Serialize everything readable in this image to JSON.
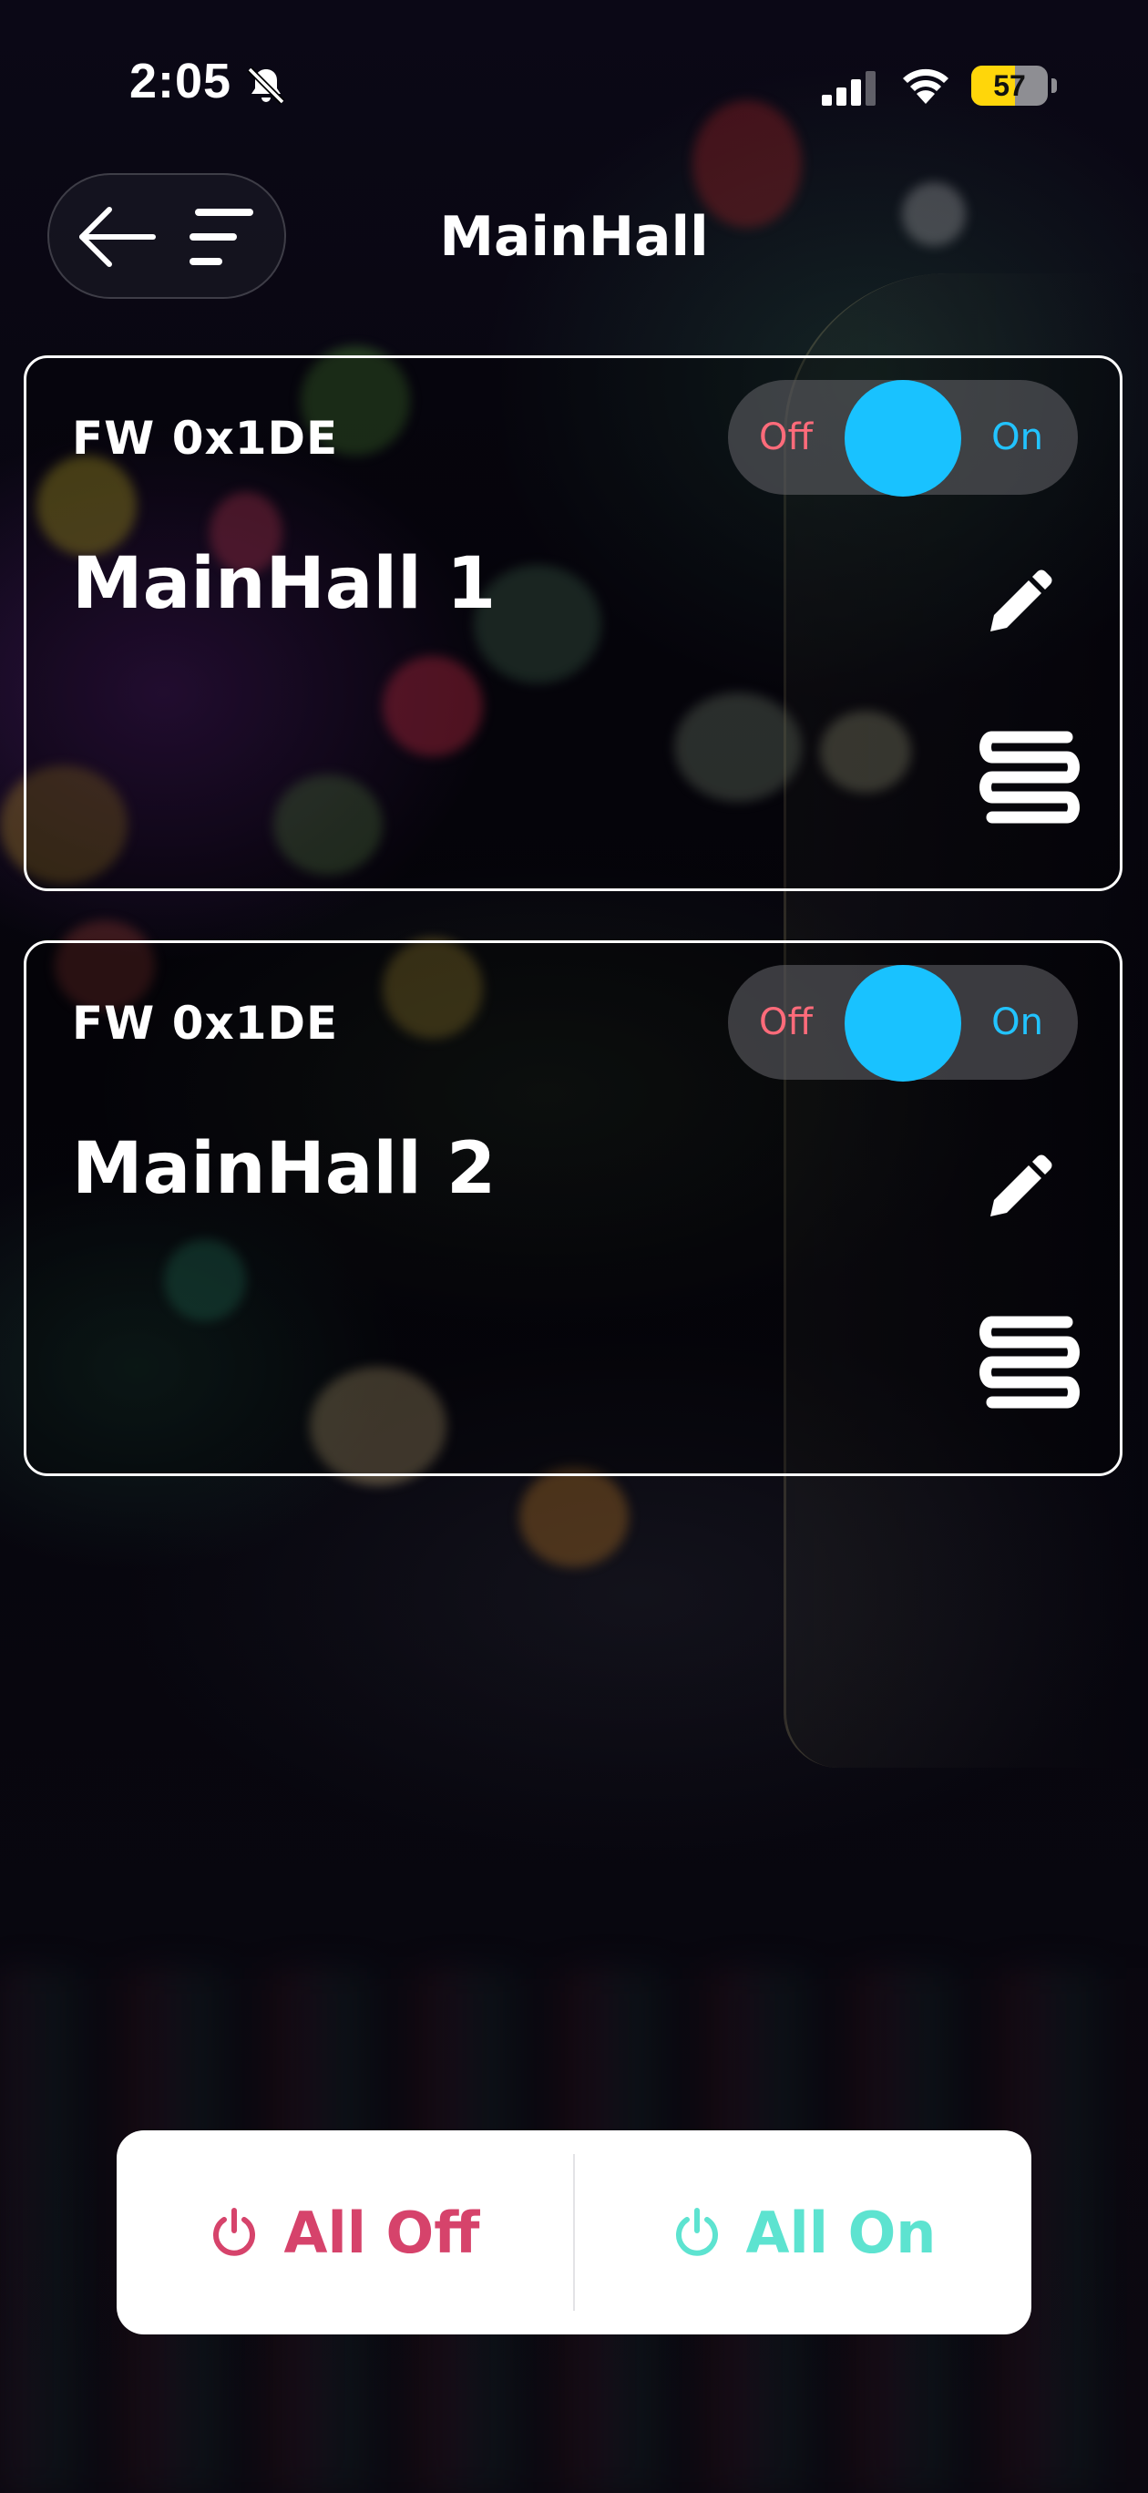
{
  "status_bar": {
    "time": "2:05",
    "battery_percent": "57",
    "battery_level": 0.57,
    "icons": [
      "bell-slash-icon",
      "cellular-signal-icon",
      "wifi-icon",
      "battery-icon"
    ]
  },
  "header": {
    "title": "MainHall",
    "back_icon": "arrow-left-icon",
    "menu_icon": "sort-menu-icon"
  },
  "devices": [
    {
      "firmware": "FW 0x1DE",
      "name": "MainHall 1",
      "toggle": {
        "off_label": "Off",
        "on_label": "On"
      },
      "edit_icon": "pencil-icon",
      "type_icon": "coil-icon"
    },
    {
      "firmware": "FW 0x1DE",
      "name": "MainHall 2",
      "toggle": {
        "off_label": "Off",
        "on_label": "On"
      },
      "edit_icon": "pencil-icon",
      "type_icon": "coil-icon"
    }
  ],
  "bottom_bar": {
    "all_off_label": "All Off",
    "all_on_label": "All On",
    "off_color": "#d6436b",
    "on_color": "#5de3d0",
    "icon": "power-icon"
  },
  "colors": {
    "accent": "#19c2ff",
    "off_text": "#ff6b7a",
    "on_text": "#22c3ff"
  }
}
